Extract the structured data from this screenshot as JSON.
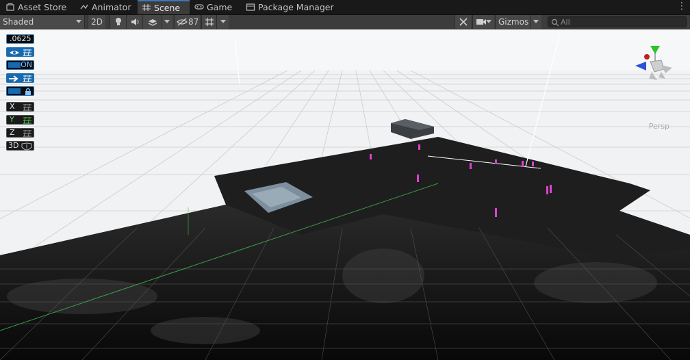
{
  "tabs": [
    {
      "label": "Asset Store",
      "icon": "asset-store-icon",
      "active": false
    },
    {
      "label": "Animator",
      "icon": "animator-icon",
      "active": false
    },
    {
      "label": "Scene",
      "icon": "scene-grid-icon",
      "active": true
    },
    {
      "label": "Game",
      "icon": "game-controller-icon",
      "active": false
    },
    {
      "label": "Package Manager",
      "icon": "package-icon",
      "active": false
    }
  ],
  "toolbar": {
    "shading_mode": "Shaded",
    "mode_2d": "2D",
    "hidden_count": "87",
    "gizmos_label": "Gizmos",
    "search_placeholder": "All"
  },
  "overlay": {
    "grid_size": ".0625",
    "toggle_on_label": "ON",
    "axis_x": "X",
    "axis_y": "Y",
    "axis_z": "Z",
    "label_3d": "3D"
  },
  "projection_label": "Persp",
  "colors": {
    "accent_blue": "#2b6fa8",
    "active_tab": "#3a79bb",
    "marker_magenta": "#e040d0",
    "grid_green": "#3fbf4f"
  }
}
